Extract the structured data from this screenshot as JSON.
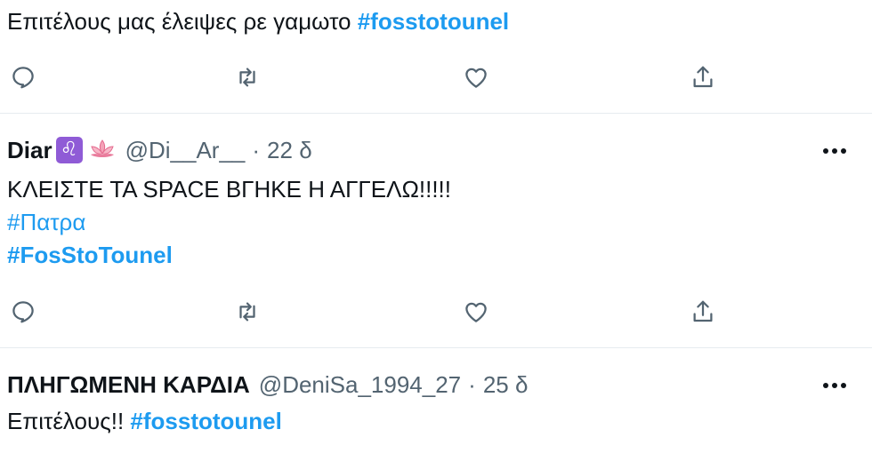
{
  "tweets": [
    {
      "text": "Επιτέλους μας έλειψες ρε γαμωτο ",
      "hashtag": "#fosstotounel"
    },
    {
      "display_name": "Diar",
      "leo_symbol": "♌",
      "handle": "@Di__Ar__",
      "separator": "·",
      "time": "22 δ",
      "line1": "ΚΛΕΙΣΤΕ ΤΑ SPACE ΒΓΗΚΕ Η ΑΓΓΕΛΩ!!!!!",
      "hashtag1": "#Πατρα",
      "hashtag2": "#FosStoTounel"
    },
    {
      "display_name": "ΠΛΗΓΩΜΕΝΗ ΚΑΡΔΙΑ",
      "handle": "@DeniSa_1994_27",
      "separator": "·",
      "time": "25 δ",
      "text": "Επιτέλους!! ",
      "hashtag": "#fosstotounel"
    }
  ],
  "icons": {
    "reply": "reply-icon",
    "retweet": "retweet-icon",
    "like": "like-icon",
    "share": "share-icon",
    "more": "more-icon"
  },
  "colors": {
    "hashtag": "#1d9bf0",
    "secondary_text": "#536471",
    "divider": "#e6ecf0",
    "leo_badge": "#8f5bd6"
  }
}
